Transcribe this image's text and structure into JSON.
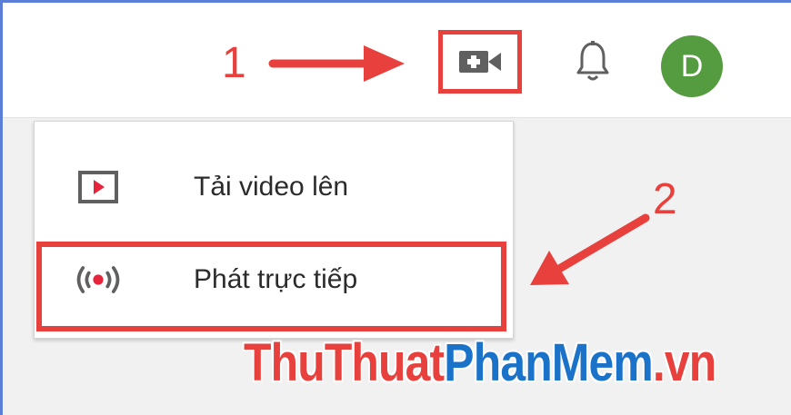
{
  "annotations": {
    "step1": "1",
    "step2": "2",
    "accent_color": "#e8403c"
  },
  "header": {
    "create_icon": "video-camera-plus-icon",
    "bell_icon": "bell-icon",
    "avatar_letter": "D",
    "avatar_color": "#559b3f"
  },
  "menu": {
    "items": [
      {
        "icon": "upload-video-icon",
        "label": "Tải video lên"
      },
      {
        "icon": "live-broadcast-icon",
        "label": "Phát trực tiếp"
      }
    ]
  },
  "watermark": {
    "part1": "ThuThuat",
    "part2": "PhanMem",
    "part3": ".vn"
  }
}
